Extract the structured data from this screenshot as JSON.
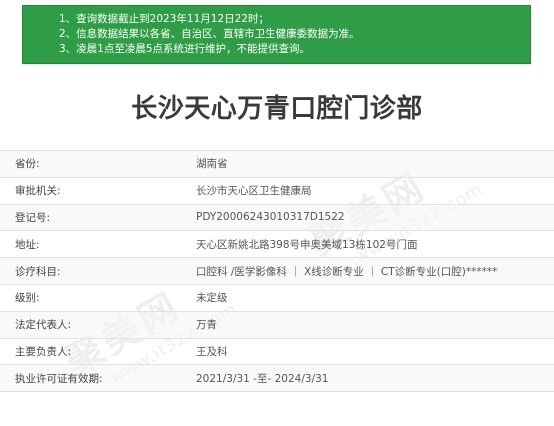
{
  "notice": {
    "lines": [
      "1、查询数据截止到2023年11月12日22时；",
      "2、信息数据结果以各省、自治区、直辖市卫生健康委数据为准。",
      "3、凌晨1点至凌晨5点系统进行维护，不能提供查询。"
    ]
  },
  "watermark": {
    "brand": "聚美网",
    "site": "www.it322.com"
  },
  "page": {
    "title": "长沙天心万青口腔门诊部"
  },
  "colors": {
    "notice_bg": "#2f9d46",
    "title_text": "#3a3a3a"
  },
  "info": {
    "rows": [
      {
        "label": "省份:",
        "value": "湖南省"
      },
      {
        "label": "审批机关:",
        "value": "长沙市天心区卫生健康局"
      },
      {
        "label": "登记号:",
        "value": "PDY20006243010317D1522"
      },
      {
        "label": "地址:",
        "value": "天心区新姚北路398号申奥美域13栋102号门面"
      },
      {
        "label": "诊疗科目:",
        "value": "口腔科 /医学影像科 ｜ X线诊断专业 ｜ CT诊断专业(口腔)******"
      },
      {
        "label": "级别:",
        "value": "未定级"
      },
      {
        "label": "法定代表人:",
        "value": "万青"
      },
      {
        "label": "主要负责人:",
        "value": "王及科"
      },
      {
        "label": "执业许可证有效期:",
        "value": "2021/3/31 -至- 2024/3/31"
      }
    ]
  }
}
